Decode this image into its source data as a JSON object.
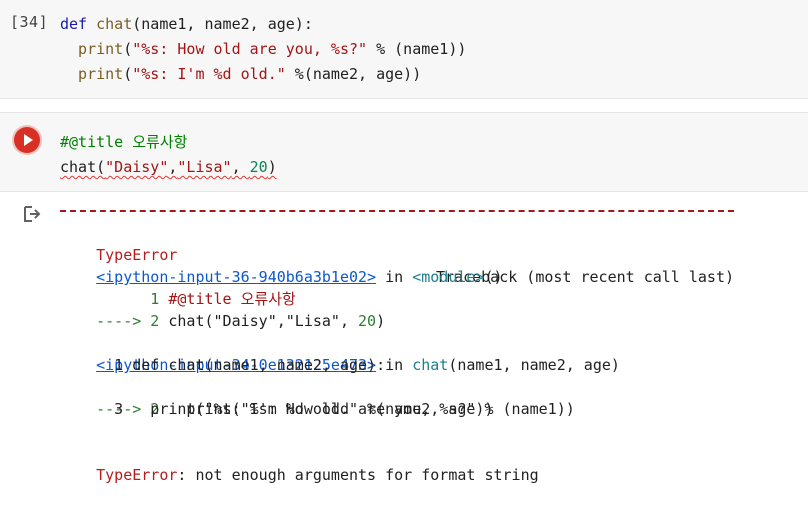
{
  "cell1": {
    "prompt": "[34]",
    "lines": [
      {
        "parts": [
          {
            "t": "def ",
            "c": "kw"
          },
          {
            "t": "chat",
            "c": "fn"
          },
          {
            "t": "(name1, name2, age):",
            "c": "plain"
          }
        ]
      },
      {
        "parts": [
          {
            "t": "  print",
            "c": "fn"
          },
          {
            "t": "(",
            "c": "plain"
          },
          {
            "t": "\"%s: How old are you, %s?\"",
            "c": "str"
          },
          {
            "t": " % (name1))",
            "c": "plain"
          }
        ]
      },
      {
        "parts": [
          {
            "t": "  print",
            "c": "fn"
          },
          {
            "t": "(",
            "c": "plain"
          },
          {
            "t": "\"%s: I'm %d old.\"",
            "c": "str"
          },
          {
            "t": " %(name2, age))",
            "c": "plain"
          }
        ]
      }
    ]
  },
  "cell2": {
    "line1": "#@title 오류사항",
    "line2_parts": [
      {
        "t": "chat(",
        "c": "plain"
      },
      {
        "t": "\"Daisy\"",
        "c": "str"
      },
      {
        "t": ",",
        "c": "plain"
      },
      {
        "t": "\"Lisa\"",
        "c": "str"
      },
      {
        "t": ", ",
        "c": "plain"
      },
      {
        "t": "20",
        "c": "num"
      },
      {
        "t": ")",
        "c": "plain"
      }
    ]
  },
  "output": {
    "header_left": "TypeError",
    "header_right": "Traceback (most recent call last)",
    "frame1_link": "<ipython-input-36-940b6a3b1e02>",
    "frame1_in": " in ",
    "frame1_module": "<module>",
    "frame1_paren": "()",
    "frame1_l1_num": "      1 ",
    "frame1_l1_code": "#@title 오류사항",
    "frame1_l2_arrow": "----> 2 ",
    "frame1_l2_parts": [
      {
        "t": "chat(",
        "c": "plain"
      },
      {
        "t": "\"Daisy\"",
        "c": "plain"
      },
      {
        "t": ",",
        "c": "plain"
      },
      {
        "t": "\"Lisa\"",
        "c": "plain"
      },
      {
        "t": ", ",
        "c": "plain"
      },
      {
        "t": "20",
        "c": "green"
      },
      {
        "t": ")",
        "c": "plain"
      }
    ],
    "frame2_link": "<ipython-input-34-0e132125e473>",
    "frame2_in": " in ",
    "frame2_fn": "chat",
    "frame2_args": "(name1, name2, age)",
    "frame2_l1": "      1 def chat(name1, name2, age):",
    "frame2_l2_arrow": "----> 2 ",
    "frame2_l2_code": "  print(\"%s: How old are you, %s?\" % (name1))",
    "frame2_l3": "      3   print(\"%s: I'm %d old.\" %(name2, age))",
    "error_type": "TypeError",
    "error_msg": ": not enough arguments for format string"
  }
}
